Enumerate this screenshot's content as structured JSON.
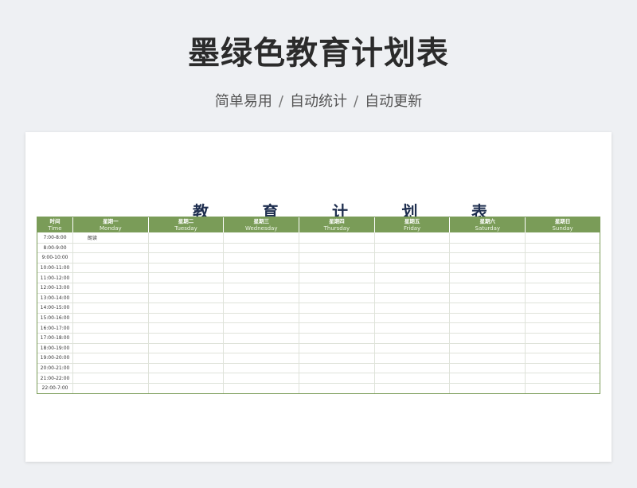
{
  "page": {
    "title": "墨绿色教育计划表",
    "subtitle_parts": [
      "简单易用",
      "自动统计",
      "自动更新"
    ],
    "separator": "/"
  },
  "sheet": {
    "title_chars": [
      "教",
      "育",
      "计",
      "划",
      "表"
    ],
    "header": [
      {
        "cn": "时间",
        "en": "Time"
      },
      {
        "cn": "星期一",
        "en": "Monday"
      },
      {
        "cn": "星期二",
        "en": "Tuesday"
      },
      {
        "cn": "星期三",
        "en": "Wednesday"
      },
      {
        "cn": "星期四",
        "en": "Thursday"
      },
      {
        "cn": "星期五",
        "en": "Friday"
      },
      {
        "cn": "星期六",
        "en": "Saturday"
      },
      {
        "cn": "星期日",
        "en": "Sunday"
      }
    ],
    "rows": [
      {
        "time": "7:00-8:00",
        "cells": [
          "朗读",
          "",
          "",
          "",
          "",
          "",
          ""
        ]
      },
      {
        "time": "8:00-9:00",
        "cells": [
          "",
          "",
          "",
          "",
          "",
          "",
          ""
        ]
      },
      {
        "time": "9:00-10:00",
        "cells": [
          "",
          "",
          "",
          "",
          "",
          "",
          ""
        ]
      },
      {
        "time": "10:00-11:00",
        "cells": [
          "",
          "",
          "",
          "",
          "",
          "",
          ""
        ]
      },
      {
        "time": "11:00-12:00",
        "cells": [
          "",
          "",
          "",
          "",
          "",
          "",
          ""
        ]
      },
      {
        "time": "12:00-13:00",
        "cells": [
          "",
          "",
          "",
          "",
          "",
          "",
          ""
        ]
      },
      {
        "time": "13:00-14:00",
        "cells": [
          "",
          "",
          "",
          "",
          "",
          "",
          ""
        ]
      },
      {
        "time": "14:00-15:00",
        "cells": [
          "",
          "",
          "",
          "",
          "",
          "",
          ""
        ]
      },
      {
        "time": "15:00-16:00",
        "cells": [
          "",
          "",
          "",
          "",
          "",
          "",
          ""
        ]
      },
      {
        "time": "16:00-17:00",
        "cells": [
          "",
          "",
          "",
          "",
          "",
          "",
          ""
        ]
      },
      {
        "time": "17:00-18:00",
        "cells": [
          "",
          "",
          "",
          "",
          "",
          "",
          ""
        ]
      },
      {
        "time": "18:00-19:00",
        "cells": [
          "",
          "",
          "",
          "",
          "",
          "",
          ""
        ]
      },
      {
        "time": "19:00-20:00",
        "cells": [
          "",
          "",
          "",
          "",
          "",
          "",
          ""
        ]
      },
      {
        "time": "20:00-21:00",
        "cells": [
          "",
          "",
          "",
          "",
          "",
          "",
          ""
        ]
      },
      {
        "time": "21:00-22:00",
        "cells": [
          "",
          "",
          "",
          "",
          "",
          "",
          ""
        ]
      },
      {
        "time": "22:00-7:00",
        "cells": [
          "",
          "",
          "",
          "",
          "",
          "",
          ""
        ]
      }
    ]
  },
  "colors": {
    "header_green": "#7a9c58",
    "title_navy": "#1e2e4f",
    "background": "#eef0f3"
  }
}
